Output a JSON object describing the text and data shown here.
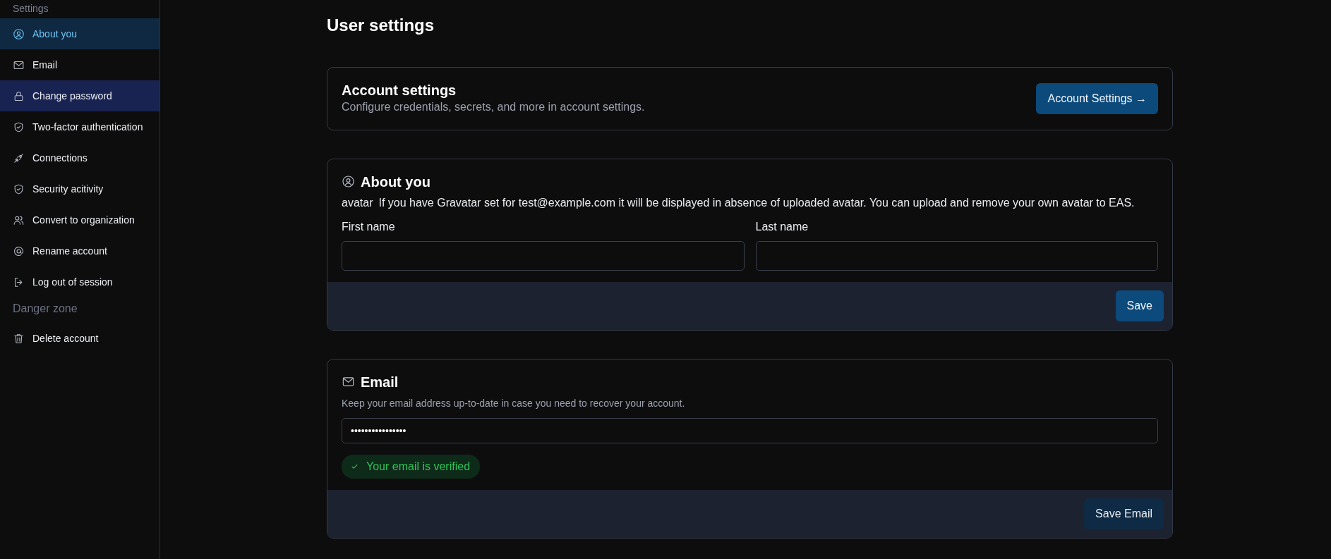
{
  "sidebar": {
    "heading": "Settings",
    "items": [
      {
        "label": "About you",
        "selected": true,
        "hovered": false
      },
      {
        "label": "Email",
        "selected": false,
        "hovered": false
      },
      {
        "label": "Change password",
        "selected": false,
        "hovered": true
      },
      {
        "label": "Two-factor authentication",
        "selected": false,
        "hovered": false
      },
      {
        "label": "Connections",
        "selected": false,
        "hovered": false
      },
      {
        "label": "Security acitivity",
        "selected": false,
        "hovered": false
      },
      {
        "label": "Convert to organization",
        "selected": false,
        "hovered": false
      },
      {
        "label": "Rename account",
        "selected": false,
        "hovered": false
      },
      {
        "label": "Log out of session",
        "selected": false,
        "hovered": false
      }
    ],
    "danger_heading": "Danger zone",
    "danger_items": [
      {
        "label": "Delete account",
        "selected": false,
        "hovered": false
      }
    ]
  },
  "page_title": "User settings",
  "account_card": {
    "title": "Account settings",
    "description": "Configure credentials, secrets, and more in account settings.",
    "button": "Account Settings →"
  },
  "about_card": {
    "title": "About you",
    "avatar_label": "avatar",
    "note": "If you have Gravatar set for test@example.com it will be displayed in absence of uploaded avatar. You can upload and remove your own avatar to EAS.",
    "fields": [
      {
        "label": "First name"
      },
      {
        "label": "Last name"
      }
    ],
    "button": {
      "label": "Save",
      "disabled": false
    }
  },
  "email_card": {
    "title": "Email",
    "description": "Keep your email address up-to-date in case you need to recover your account.",
    "value": "••••••••••••••••",
    "verified": true,
    "verified_label": "Your email is verified",
    "button": {
      "label": "Save Email",
      "disabled": true
    }
  }
}
